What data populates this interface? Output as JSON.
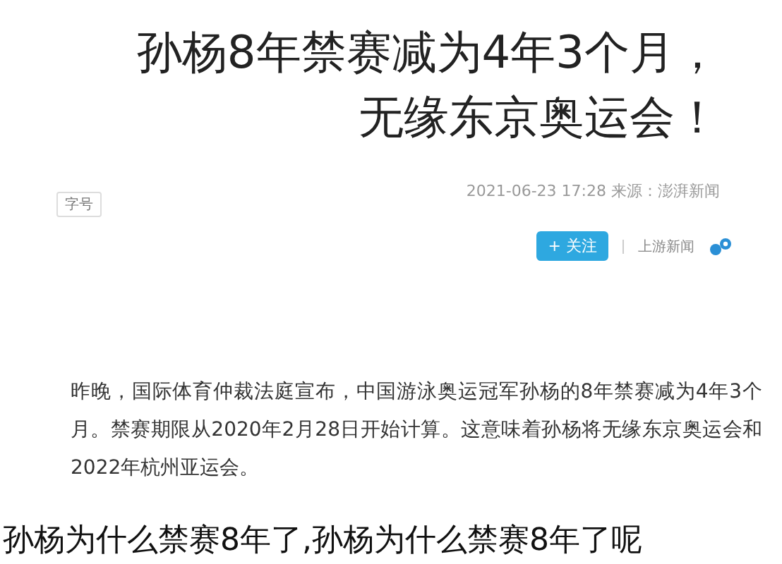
{
  "article": {
    "title": "孙杨8年禁赛减为4年3个月，无缘东京奥运会！",
    "meta": "2021-06-23 17:28 来源：澎湃新闻",
    "font_size_button": "字号",
    "author": "上游新闻",
    "follow_button": {
      "icon": "+",
      "label": "关注"
    },
    "paragraphs": [
      "昨晚，国际体育仲裁法庭宣布，中国游泳奥运冠军孙杨的8年禁赛减为4年3个月。禁赛期限从2020年2月28日开始计算。这意味着孙杨将无缘东京奥运会和2022年杭州亚运会。"
    ]
  },
  "caption": "孙杨为什么禁赛8年了,孙杨为什么禁赛8年了呢"
}
